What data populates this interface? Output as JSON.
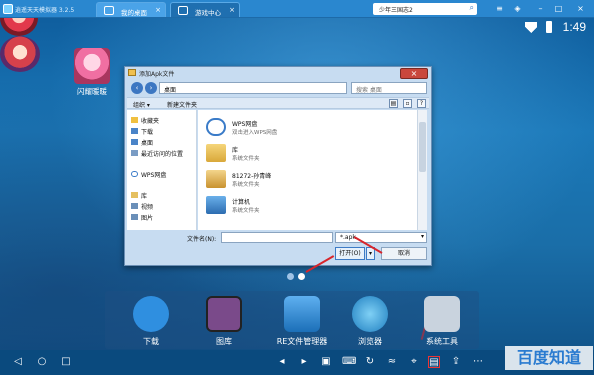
{
  "emulator": {
    "title": "逍遥天天模拟器 3.2.5",
    "tabs": [
      {
        "label": "我的桌面"
      },
      {
        "label": "游戏中心"
      }
    ],
    "search": {
      "value": "少年三国志2"
    }
  },
  "statusbar": {
    "time": "1:49"
  },
  "desktop": {
    "apps": [
      {
        "label": "闪耀暖暖"
      }
    ]
  },
  "dialog": {
    "title": "添加Apk文件",
    "path": "桌面",
    "search_placeholder": "搜索 桌面",
    "toolbar": {
      "organize": "组织 ▾",
      "new_folder": "新建文件夹"
    },
    "sidebar": [
      "收藏夹",
      "下载",
      "桌面",
      "最近访问的位置",
      "WPS网盘",
      "库",
      "视频",
      "图片"
    ],
    "files": [
      {
        "name": "WPS网盘",
        "sub": "双击进入WPS网盘"
      },
      {
        "name": "库",
        "sub": "系统文件夹"
      },
      {
        "name": "81272-孙青峰",
        "sub": "系统文件夹"
      },
      {
        "name": "计算机",
        "sub": "系统文件夹"
      }
    ],
    "filename_label": "文件名(N):",
    "filter": "*.apk",
    "open_label": "打开(O)",
    "cancel_label": "取消"
  },
  "dock": {
    "apps": [
      {
        "label": "下载",
        "color": "#2f8fe0"
      },
      {
        "label": "图库",
        "color": "#7a4a8a"
      },
      {
        "label": "RE文件管理器",
        "color": "#1b6fb8"
      },
      {
        "label": "浏览器",
        "color": "#2aa0d8"
      },
      {
        "label": "系统工具",
        "color": "#c9d3de"
      }
    ]
  },
  "watermark": "百度知道"
}
